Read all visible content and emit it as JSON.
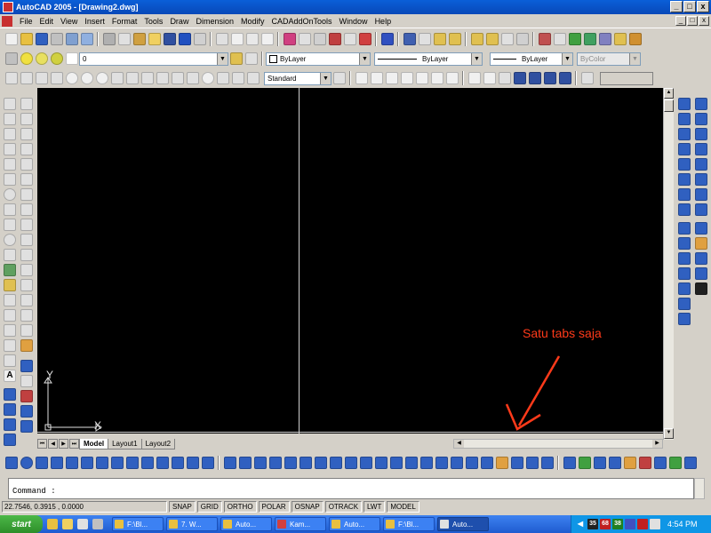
{
  "window": {
    "title": "AutoCAD 2005 - [Drawing2.dwg]",
    "min": "_",
    "max": "□",
    "close": "x"
  },
  "menu": [
    "File",
    "Edit",
    "View",
    "Insert",
    "Format",
    "Tools",
    "Draw",
    "Dimension",
    "Modify",
    "CADAddOnTools",
    "Window",
    "Help"
  ],
  "layers": {
    "current": "0"
  },
  "properties": {
    "color": "ByLayer",
    "linetype": "ByLayer",
    "lineweight": "ByLayer",
    "plotstyle": "ByColor"
  },
  "styles": {
    "dimstyle": "Standard"
  },
  "ucs": {
    "x": "X",
    "y": "Y"
  },
  "annotation": {
    "text": "Satu tabs saja",
    "color": "#ff3a1a"
  },
  "tabs": [
    {
      "label": "Model",
      "active": true
    },
    {
      "label": "Layout1",
      "active": false
    },
    {
      "label": "Layout2",
      "active": false
    }
  ],
  "command": {
    "prompt": "Command :"
  },
  "status": {
    "coords": "22.7546, 0.3915 , 0.0000",
    "buttons": [
      "SNAP",
      "GRID",
      "ORTHO",
      "POLAR",
      "OSNAP",
      "OTRACK",
      "LWT",
      "MODEL"
    ]
  },
  "taskbar": {
    "start": "start",
    "items": [
      {
        "label": "F:\\Bl..."
      },
      {
        "label": "7. W..."
      },
      {
        "label": "Auto..."
      },
      {
        "label": "Kam..."
      },
      {
        "label": "Auto..."
      },
      {
        "label": "F:\\Bl..."
      },
      {
        "label": "Auto..."
      }
    ],
    "tray_numbers": [
      "35",
      "68",
      "38"
    ],
    "clock": "4:54 PM"
  }
}
